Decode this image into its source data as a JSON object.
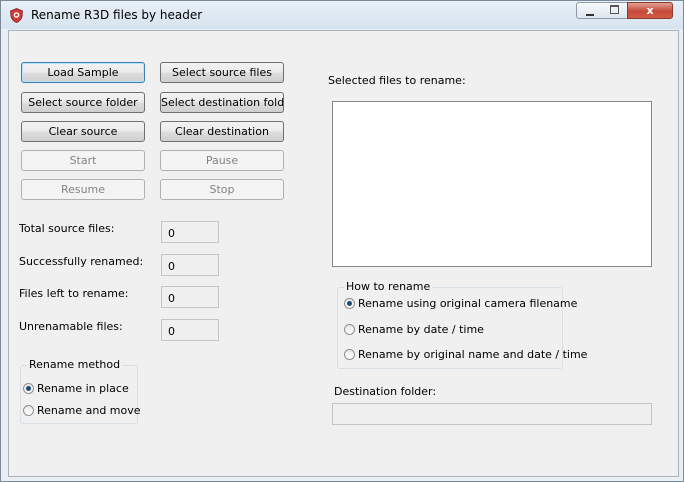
{
  "window": {
    "title": "Rename R3D files by header",
    "close_label": "x"
  },
  "buttons": {
    "load_sample": "Load Sample",
    "select_source_files": "Select source files",
    "select_source_folder": "Select source folder",
    "select_destination_folder": "Select destination folder",
    "clear_source": "Clear source",
    "clear_destination": "Clear destination",
    "start": "Start",
    "pause": "Pause",
    "resume": "Resume",
    "stop": "Stop"
  },
  "stats": [
    {
      "label": "Total source files:",
      "value": "0"
    },
    {
      "label": "Successfully renamed:",
      "value": "0"
    },
    {
      "label": "Files left to rename:",
      "value": "0"
    },
    {
      "label": "Unrenamable files:",
      "value": "0"
    }
  ],
  "rename_method": {
    "title": "Rename method",
    "options": [
      "Rename in place",
      "Rename and move"
    ],
    "selected": "Rename in place"
  },
  "files_label": "Selected files to rename:",
  "how_to_rename": {
    "title": "How to rename",
    "options": [
      "Rename using original camera filename",
      "Rename by date / time",
      "Rename by original name and  date / time"
    ],
    "selected": "Rename using original camera filename"
  },
  "destination": {
    "label": "Destination folder:",
    "value": ""
  }
}
